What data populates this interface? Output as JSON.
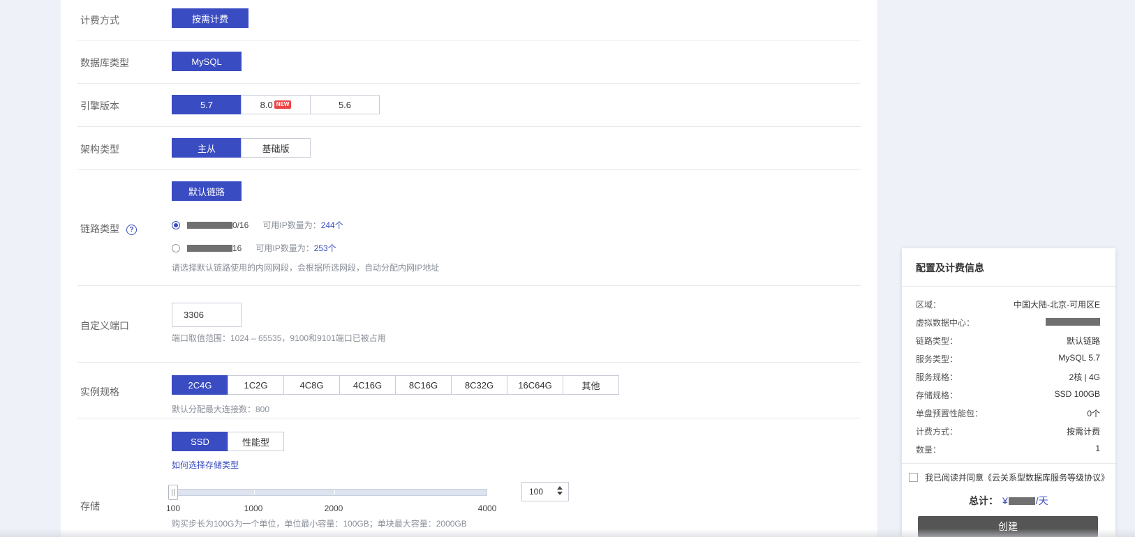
{
  "billing": {
    "label": "计费方式",
    "options": [
      "按需计费"
    ]
  },
  "db_type": {
    "label": "数据库类型",
    "options": [
      "MySQL"
    ]
  },
  "engine": {
    "label": "引擎版本",
    "options": [
      "5.7",
      "8.0",
      "5.6"
    ],
    "new_badge": "NEW"
  },
  "arch": {
    "label": "架构类型",
    "options": [
      "主从",
      "基础版"
    ]
  },
  "link": {
    "label": "链路类型",
    "help_icon": "question-icon",
    "option": "默认链路",
    "subnets": [
      {
        "suffix": "0/16",
        "ip_label": "可用IP数量为：",
        "ip_count": "244个"
      },
      {
        "suffix": "16",
        "ip_label": "可用IP数量为：",
        "ip_count": "253个"
      }
    ],
    "hint": "请选择默认链路使用的内网网段，会根据所选网段，自动分配内网IP地址"
  },
  "port": {
    "label": "自定义端口",
    "value": "3306",
    "hint": "端口取值范围：1024 – 65535，9100和9101端口已被占用"
  },
  "spec": {
    "label": "实例规格",
    "options": [
      "2C4G",
      "1C2G",
      "4C8G",
      "4C16G",
      "8C16G",
      "8C32G",
      "16C64G",
      "其他"
    ],
    "hint": "默认分配最大连接数：800"
  },
  "storage": {
    "label": "存储",
    "options": [
      "SSD",
      "性能型"
    ],
    "link": "如何选择存储类型",
    "scale": [
      "100",
      "1000",
      "2000",
      "4000"
    ],
    "value": "100",
    "hint": "购买步长为100G为一个单位，单位最小容量：100GB；单块最大容量：2000GB"
  },
  "summary": {
    "title": "配置及计费信息",
    "rows": [
      {
        "key": "区域：",
        "val": "中国大陆-北京-可用区E"
      },
      {
        "key": "虚拟数据中心：",
        "val": ""
      },
      {
        "key": "链路类型：",
        "val": "默认链路"
      },
      {
        "key": "服务类型：",
        "val": "MySQL 5.7"
      },
      {
        "key": "服务规格：",
        "val": "2核 | 4G"
      },
      {
        "key": "存储规格：",
        "val": "SSD 100GB"
      },
      {
        "key": "单盘预置性能包：",
        "val": "0个"
      },
      {
        "key": "计费方式：",
        "val": "按需计费"
      },
      {
        "key": "数量：",
        "val": "1"
      }
    ],
    "agreement": "我已阅读并同意《云关系型数据库服务等级协议》",
    "total_label": "总计：",
    "currency": "¥",
    "per_day": "/天",
    "create_button": "创建"
  }
}
